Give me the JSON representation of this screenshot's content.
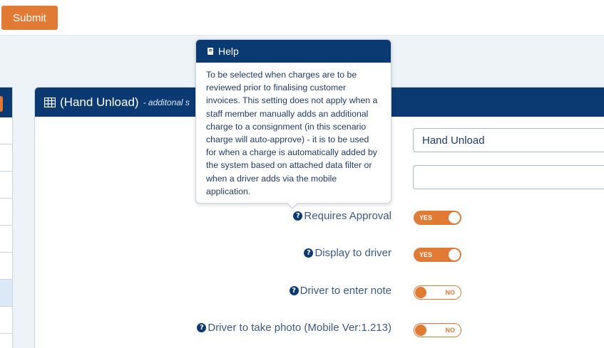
{
  "toolbar": {
    "submit_label": "Submit"
  },
  "panel": {
    "title": "(Hand Unload)",
    "subtitle": "- additonal s"
  },
  "fields": {
    "name_value": "Hand Unload",
    "second_value": ""
  },
  "toggles": [
    {
      "label": "Requires Approval",
      "state": "YES"
    },
    {
      "label": "Display to driver",
      "state": "YES"
    },
    {
      "label": "Driver to enter note",
      "state": "NO"
    },
    {
      "label": "Driver to take photo (Mobile Ver:1.213)",
      "state": "NO"
    }
  ],
  "popover": {
    "title": "Help",
    "body": "To be selected when charges are to be reviewed prior to finalising customer invoices. This setting does not apply when a staff member manually adds an additional charge to a consignment (in this scenario charge will auto-approve) - it is to be used for when a charge is automatically added by the system based on attached data filter or when a driver adds via the mobile application."
  },
  "icons": {
    "help": "question-circle-icon",
    "panel": "table-icon",
    "popover": "book-icon"
  },
  "colors": {
    "accent": "#e07a35",
    "header": "#0b3a73",
    "label": "#3a5a86"
  }
}
